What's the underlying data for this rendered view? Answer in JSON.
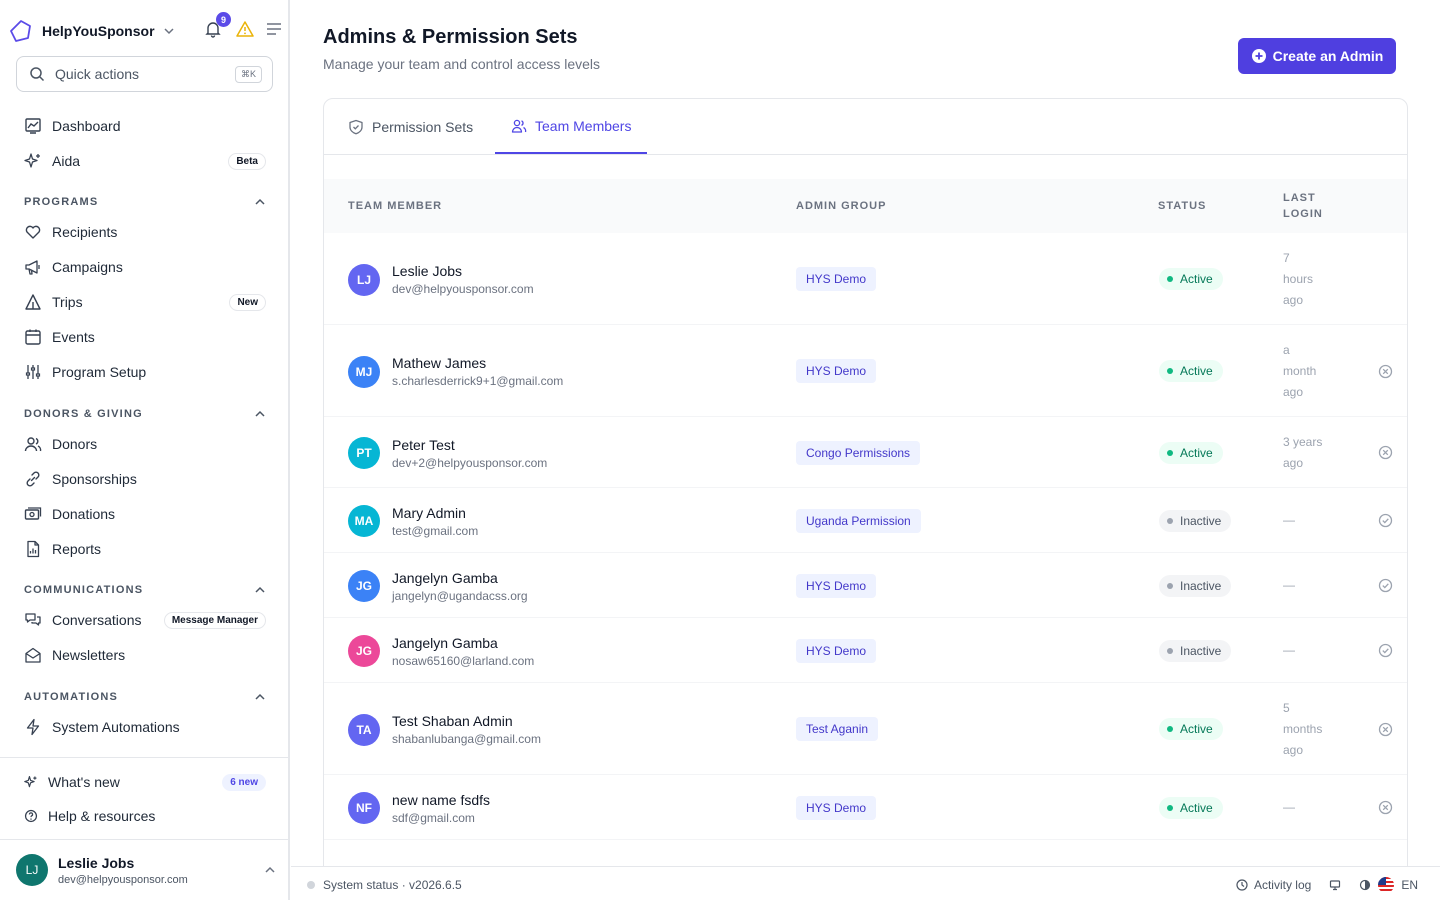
{
  "brand": {
    "name": "HelpYouSponsor",
    "notifications": "9"
  },
  "quick_actions": {
    "label": "Quick actions",
    "shortcut": "⌘K"
  },
  "nav": {
    "dashboard": "Dashboard",
    "aida": "Aida",
    "aida_badge": "Beta",
    "programs_title": "PROGRAMS",
    "recipients": "Recipients",
    "campaigns": "Campaigns",
    "trips": "Trips",
    "trips_badge": "New",
    "events": "Events",
    "program_setup": "Program Setup",
    "donors_title": "DONORS & GIVING",
    "donors": "Donors",
    "sponsorships": "Sponsorships",
    "donations": "Donations",
    "reports": "Reports",
    "comms_title": "COMMUNICATIONS",
    "conversations": "Conversations",
    "conversations_badge": "Message Manager",
    "newsletters": "Newsletters",
    "automations_title": "AUTOMATIONS",
    "system_automations": "System Automations",
    "whats_new": "What's new",
    "whats_new_badge": "6 new",
    "help": "Help & resources"
  },
  "current_user": {
    "initials": "LJ",
    "name": "Leslie Jobs",
    "email": "dev@helpyousponsor.com"
  },
  "header": {
    "title": "Admins & Permission Sets",
    "subtitle": "Manage your team and control access levels",
    "create_button": "Create an Admin"
  },
  "tabs": {
    "permission_sets": "Permission Sets",
    "team_members": "Team Members"
  },
  "table": {
    "columns": {
      "member": "TEAM MEMBER",
      "group": "ADMIN GROUP",
      "status": "STATUS",
      "last_login_1": "LAST",
      "last_login_2": "LOGIN"
    },
    "rows": [
      {
        "initials": "LJ",
        "name": "Leslie Jobs",
        "email": "dev@helpyousponsor.com",
        "group": "HYS Demo",
        "status": "Active",
        "login": [
          "7",
          "hours",
          "ago"
        ],
        "color": "#6366f1"
      },
      {
        "initials": "MJ",
        "name": "Mathew James",
        "email": "s.charlesderrick9+1@gmail.com",
        "group": "HYS Demo",
        "status": "Active",
        "login": [
          "a",
          "month",
          "ago"
        ],
        "color": "#3b82f6"
      },
      {
        "initials": "PT",
        "name": "Peter Test",
        "email": "dev+2@helpyousponsor.com",
        "group": "Congo Permissions",
        "status": "Active",
        "login": [
          "3 years",
          "ago"
        ],
        "color": "#06b6d4"
      },
      {
        "initials": "MA",
        "name": "Mary Admin",
        "email": "test@gmail.com",
        "group": "Uganda Permission",
        "status": "Inactive",
        "login": [
          "—"
        ],
        "color": "#06b6d4"
      },
      {
        "initials": "JG",
        "name": "Jangelyn Gamba",
        "email": "jangelyn@ugandacss.org",
        "group": "HYS Demo",
        "status": "Inactive",
        "login": [
          "—"
        ],
        "color": "#3b82f6"
      },
      {
        "initials": "JG",
        "name": "Jangelyn Gamba",
        "email": "nosaw65160@larland.com",
        "group": "HYS Demo",
        "status": "Inactive",
        "login": [
          "—"
        ],
        "color": "#ec4899"
      },
      {
        "initials": "TA",
        "name": "Test Shaban Admin",
        "email": "shabanlubanga@gmail.com",
        "group": "Test Aganin",
        "status": "Active",
        "login": [
          "5",
          "months",
          "ago"
        ],
        "color": "#6366f1"
      },
      {
        "initials": "NF",
        "name": "new name fsdfs",
        "email": "sdf@gmail.com",
        "group": "HYS Demo",
        "status": "Active",
        "login": [
          "—"
        ],
        "color": "#6366f1"
      }
    ]
  },
  "footer": {
    "system_status": "System status · v2026.6.5",
    "activity_log": "Activity log",
    "language": "EN"
  }
}
